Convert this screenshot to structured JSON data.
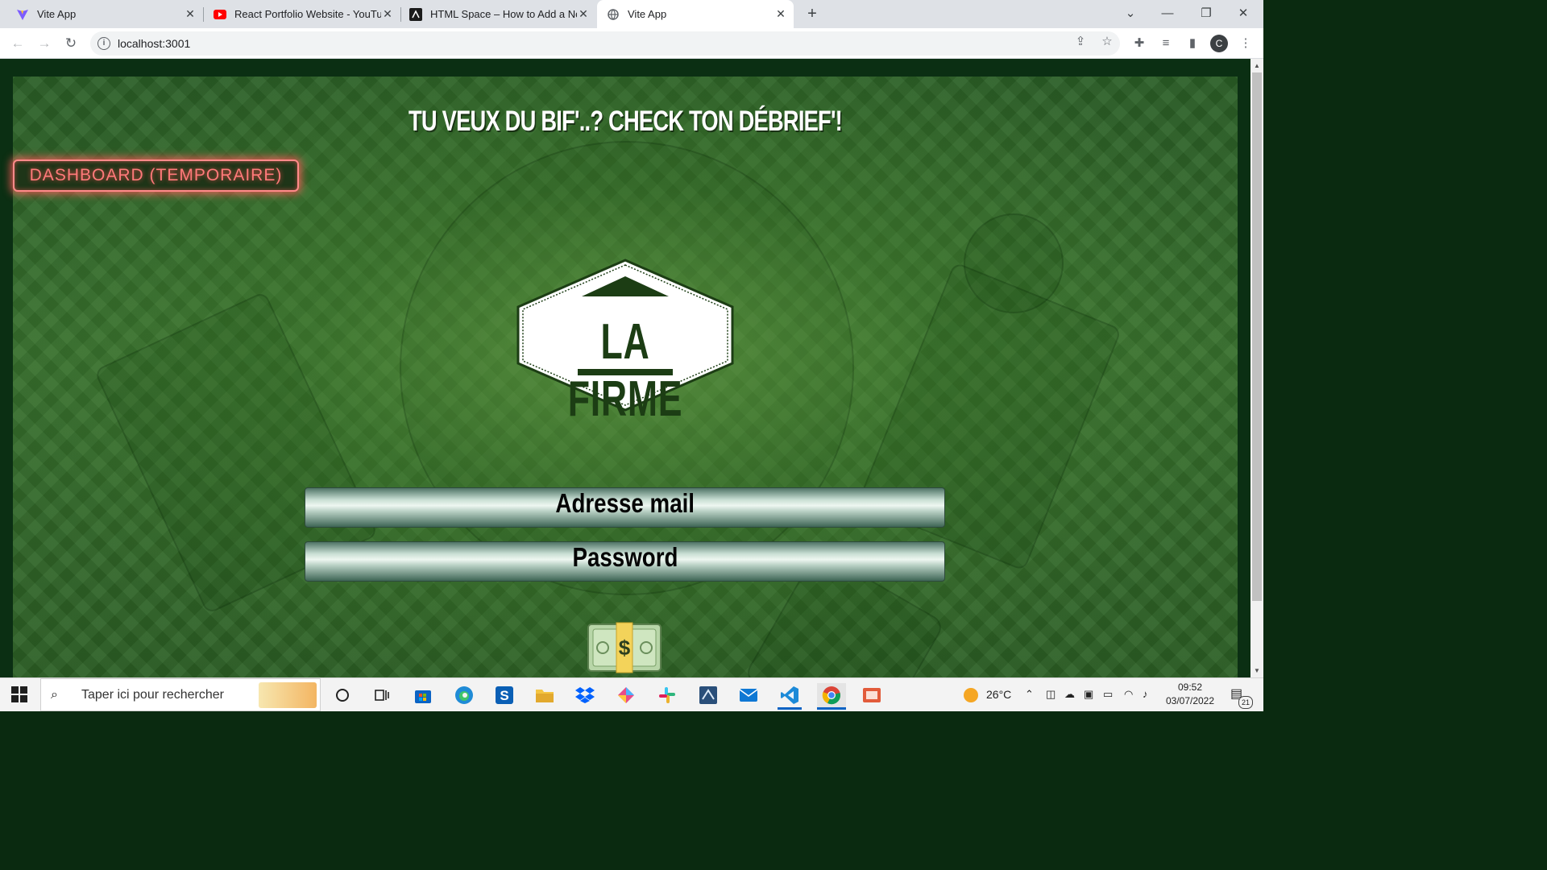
{
  "browser": {
    "tabs": [
      {
        "title": "Vite App",
        "icon": "vite-icon",
        "active": false
      },
      {
        "title": "React Portfolio Website - YouTube",
        "icon": "youtube-icon",
        "active": false
      },
      {
        "title": "HTML Space – How to Add a Non",
        "icon": "htmlspace-icon",
        "active": false
      },
      {
        "title": "Vite App",
        "icon": "globe-icon",
        "active": true
      }
    ],
    "url": "localhost:3001",
    "profile_initial": "C"
  },
  "page": {
    "heading": "TU VEUX DU BIF'..? CHECK TON DÉBRIEF'!",
    "dashboard_button": "DASHBOARD (TEMPORAIRE)",
    "logo_text": "LA FIRME",
    "email_field": "Adresse mail",
    "password_field": "Password",
    "submit_icon": "money-bill-icon"
  },
  "taskbar": {
    "search_placeholder": "Taper ici pour rechercher",
    "weather": "26°C",
    "time": "09:52",
    "date": "03/07/2022",
    "notification_count": "21"
  }
}
